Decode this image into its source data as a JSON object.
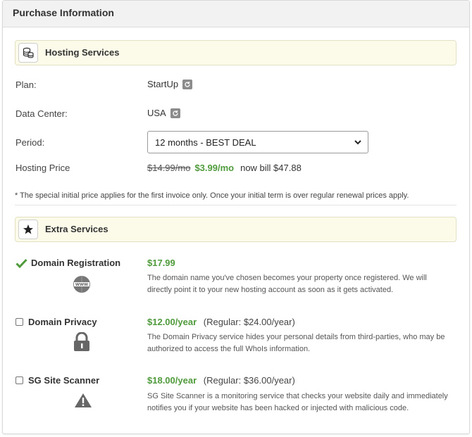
{
  "panel": {
    "title": "Purchase Information"
  },
  "hosting": {
    "section_title": "Hosting Services",
    "plan": {
      "label": "Plan:",
      "value": "StartUp"
    },
    "data_center": {
      "label": "Data Center:",
      "value": "USA"
    },
    "period": {
      "label": "Period:",
      "selected": "12 months - BEST DEAL"
    },
    "price": {
      "label": "Hosting Price",
      "old": "$14.99/mo",
      "new": "$3.99/mo",
      "bill": "now bill $47.88"
    },
    "note": "* The special initial price applies for the first invoice only. Once your initial term is over regular renewal prices apply."
  },
  "extra": {
    "section_title": "Extra Services",
    "services": [
      {
        "name": "Domain Registration",
        "price": "$17.99",
        "regular": "",
        "selected": true,
        "icon": "www-icon",
        "icon_text": "WWW",
        "desc_line1": "The domain name you've chosen becomes your property once registered. We will",
        "desc_line2": "directly point it to your new hosting account as soon as it gets activated."
      },
      {
        "name": "Domain Privacy",
        "price": "$12.00/year",
        "regular": "(Regular: $24.00/year)",
        "selected": false,
        "icon": "lock-icon",
        "desc_line1": "The Domain Privacy service hides your personal details from third-parties, who may be",
        "desc_line2": "authorized to access the full WhoIs information."
      },
      {
        "name": "SG Site Scanner",
        "price": "$18.00/year",
        "regular": "(Regular: $36.00/year)",
        "selected": false,
        "icon": "warning-icon",
        "desc_line1": "SG Site Scanner is a monitoring service that checks your website daily and immediately",
        "desc_line2": "notifies you if your website has been hacked or injected with malicious code."
      }
    ]
  },
  "colors": {
    "accent_green": "#4f9a3b",
    "section_bg": "#fcfbea"
  }
}
